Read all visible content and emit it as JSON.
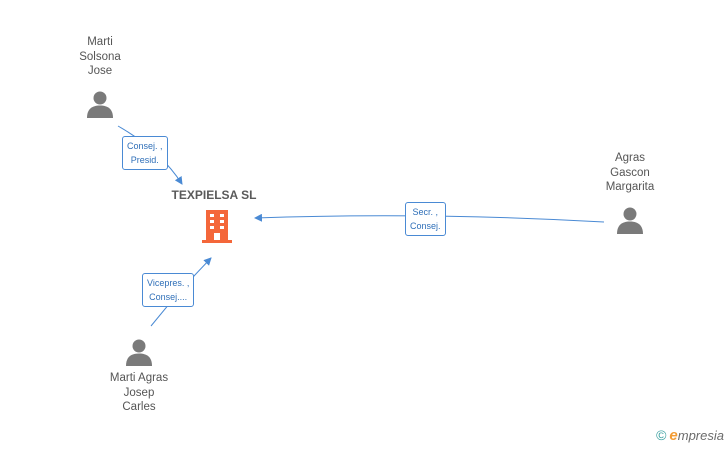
{
  "company": {
    "name": "TEXPIELSA SL",
    "icon": "building-icon",
    "color": "#f4673a"
  },
  "people": [
    {
      "id": "p1",
      "name_lines": [
        "Marti",
        "Solsona",
        "Jose"
      ],
      "icon": "person-icon"
    },
    {
      "id": "p2",
      "name_lines": [
        "Agras",
        "Gascon",
        "Margarita"
      ],
      "icon": "person-icon"
    },
    {
      "id": "p3",
      "name_lines": [
        "Marti Agras",
        "Josep",
        "Carles"
      ],
      "icon": "person-icon"
    }
  ],
  "relations": [
    {
      "from": "p1",
      "lines": [
        "Consej. ,",
        "Presid."
      ]
    },
    {
      "from": "p2",
      "lines": [
        "Secr. ,",
        "Consej."
      ]
    },
    {
      "from": "p3",
      "lines": [
        "Vicepres. ,",
        "Consej...."
      ]
    }
  ],
  "branding": {
    "copyright": "©",
    "e": "e",
    "rest": "mpresia"
  },
  "colors": {
    "edge": "#4a8ad4",
    "person": "#7a7a7a",
    "company": "#f4673a"
  }
}
